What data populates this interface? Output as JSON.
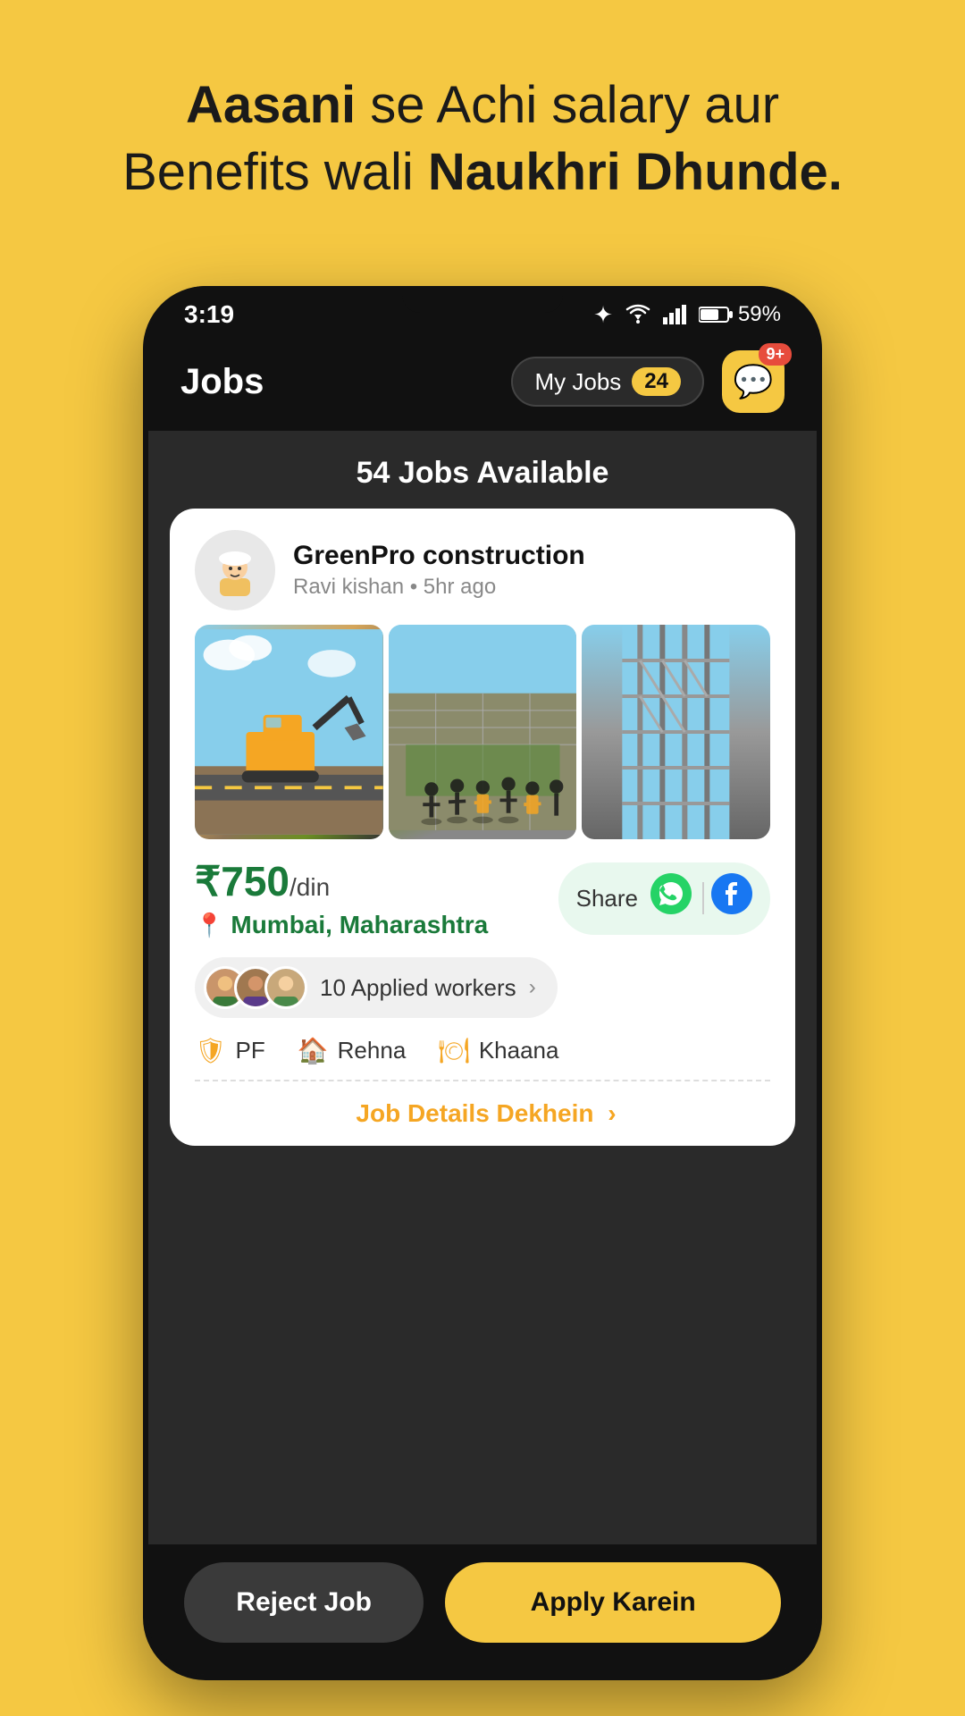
{
  "hero": {
    "line1_regular": "se Achi salary aur",
    "line1_bold": "Aasani",
    "line2_regular": "Benefits wali",
    "line2_bold": "Naukhri Dhunde."
  },
  "status_bar": {
    "time": "3:19",
    "battery": "59%"
  },
  "header": {
    "title": "Jobs",
    "my_jobs_label": "My Jobs",
    "my_jobs_count": "24",
    "chat_notif": "9+"
  },
  "jobs_available": {
    "text": "54 Jobs Available"
  },
  "job_card": {
    "company_name": "GreenPro construction",
    "company_meta": "Ravi kishan • 5hr ago",
    "salary": "₹750",
    "salary_unit": "/din",
    "location": "Mumbai, Maharashtra",
    "share_label": "Share",
    "applied_count": "10 Applied workers",
    "benefits": [
      "PF",
      "Rehna",
      "Khaana"
    ],
    "job_details_link": "Job Details Dekhein",
    "job_details_arrow": "›"
  },
  "buttons": {
    "reject": "Reject Job",
    "apply": "Apply Karein"
  }
}
